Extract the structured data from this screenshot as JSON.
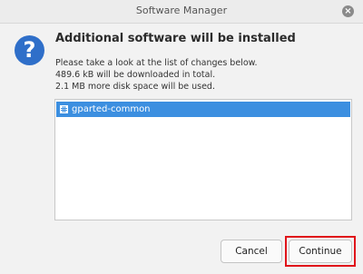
{
  "window": {
    "title": "Software Manager",
    "close_symbol": "×"
  },
  "icon": {
    "name": "question-icon",
    "glyph": "?",
    "color": "#2f6fc9"
  },
  "heading": "Additional software will be installed",
  "description": {
    "line1": "Please take a look at the list of changes below.",
    "line2": "489.6 kB will be downloaded in total.",
    "line3": "2.1 MB more disk space will be used."
  },
  "changes": {
    "items": [
      {
        "label": "gparted-common",
        "selected": true
      }
    ]
  },
  "buttons": {
    "cancel_label": "Cancel",
    "continue_label": "Continue"
  },
  "highlight_color": "#e0141a",
  "selection_color": "#3c8fe0"
}
